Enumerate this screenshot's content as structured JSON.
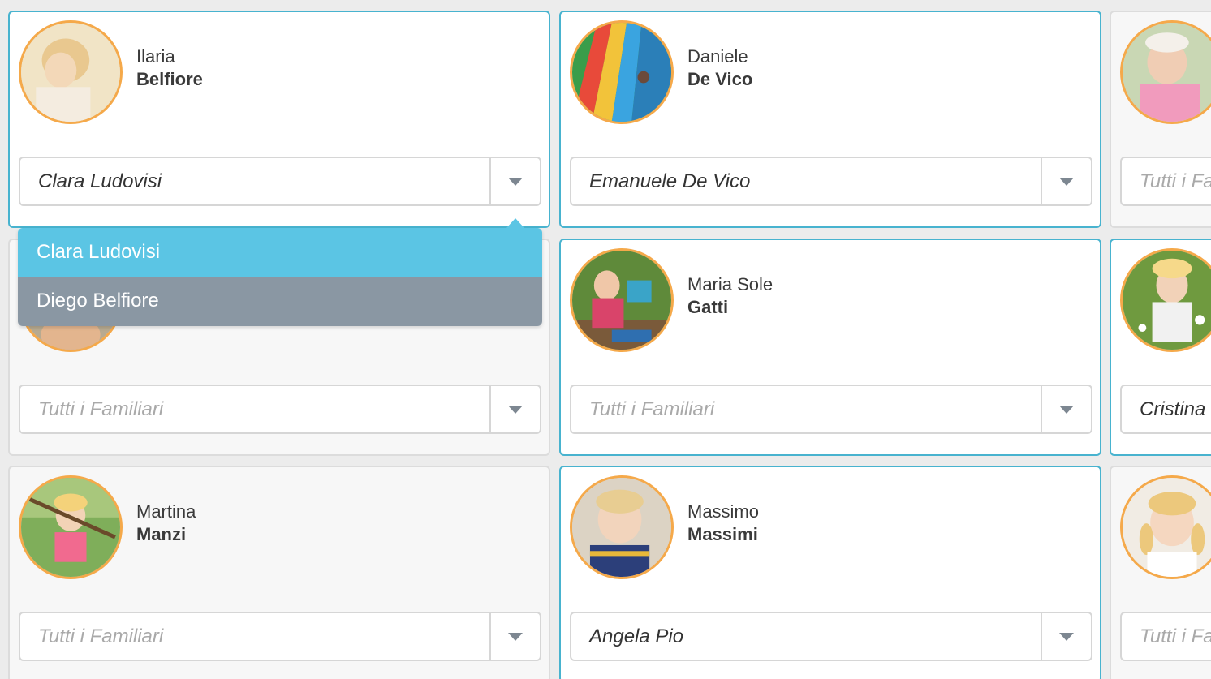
{
  "cards": [
    {
      "first_name": "Ilaria",
      "last_name": "Belfiore",
      "selected": "Clara Ludovisi",
      "is_placeholder": false,
      "active": true,
      "avatar": "child-photo-blonde-girl"
    },
    {
      "first_name": "Daniele",
      "last_name": "De Vico",
      "selected": "Emanuele De Vico",
      "is_placeholder": false,
      "active": true,
      "avatar": "child-photo-waterslide"
    },
    {
      "first_name": "",
      "last_name": "",
      "selected": "Tutti i Familiari",
      "is_placeholder": true,
      "active": false,
      "avatar": "child-photo-pink-jacket"
    },
    {
      "first_name": "",
      "last_name": "",
      "selected": "Tutti i Familiari",
      "is_placeholder": true,
      "active": false,
      "avatar": "child-photo-partial"
    },
    {
      "first_name": "Maria Sole",
      "last_name": "Gatti",
      "selected": "Tutti i Familiari",
      "is_placeholder": true,
      "active": true,
      "avatar": "child-photo-playing-outdoors"
    },
    {
      "first_name": "",
      "last_name": "",
      "selected": "Cristina",
      "is_placeholder": false,
      "active": true,
      "avatar": "child-photo-meadow"
    },
    {
      "first_name": "Martina",
      "last_name": "Manzi",
      "selected": "Tutti i Familiari",
      "is_placeholder": true,
      "active": false,
      "avatar": "child-photo-playground"
    },
    {
      "first_name": "Massimo",
      "last_name": "Massimi",
      "selected": "Angela Pio",
      "is_placeholder": false,
      "active": true,
      "avatar": "child-photo-blonde-boy"
    },
    {
      "first_name": "",
      "last_name": "",
      "selected": "Tutti i Familiari",
      "is_placeholder": true,
      "active": false,
      "avatar": "child-photo-pigtails"
    }
  ],
  "dropdown": {
    "options": [
      "Clara Ludovisi",
      "Diego Belfiore"
    ],
    "selected_index": 0
  },
  "colors": {
    "active_border": "#48b3cf",
    "inactive_border": "#dcdcdc",
    "avatar_ring": "#f5a94a",
    "option_selected": "#5bc5e4",
    "option_other": "#8a97a3"
  }
}
